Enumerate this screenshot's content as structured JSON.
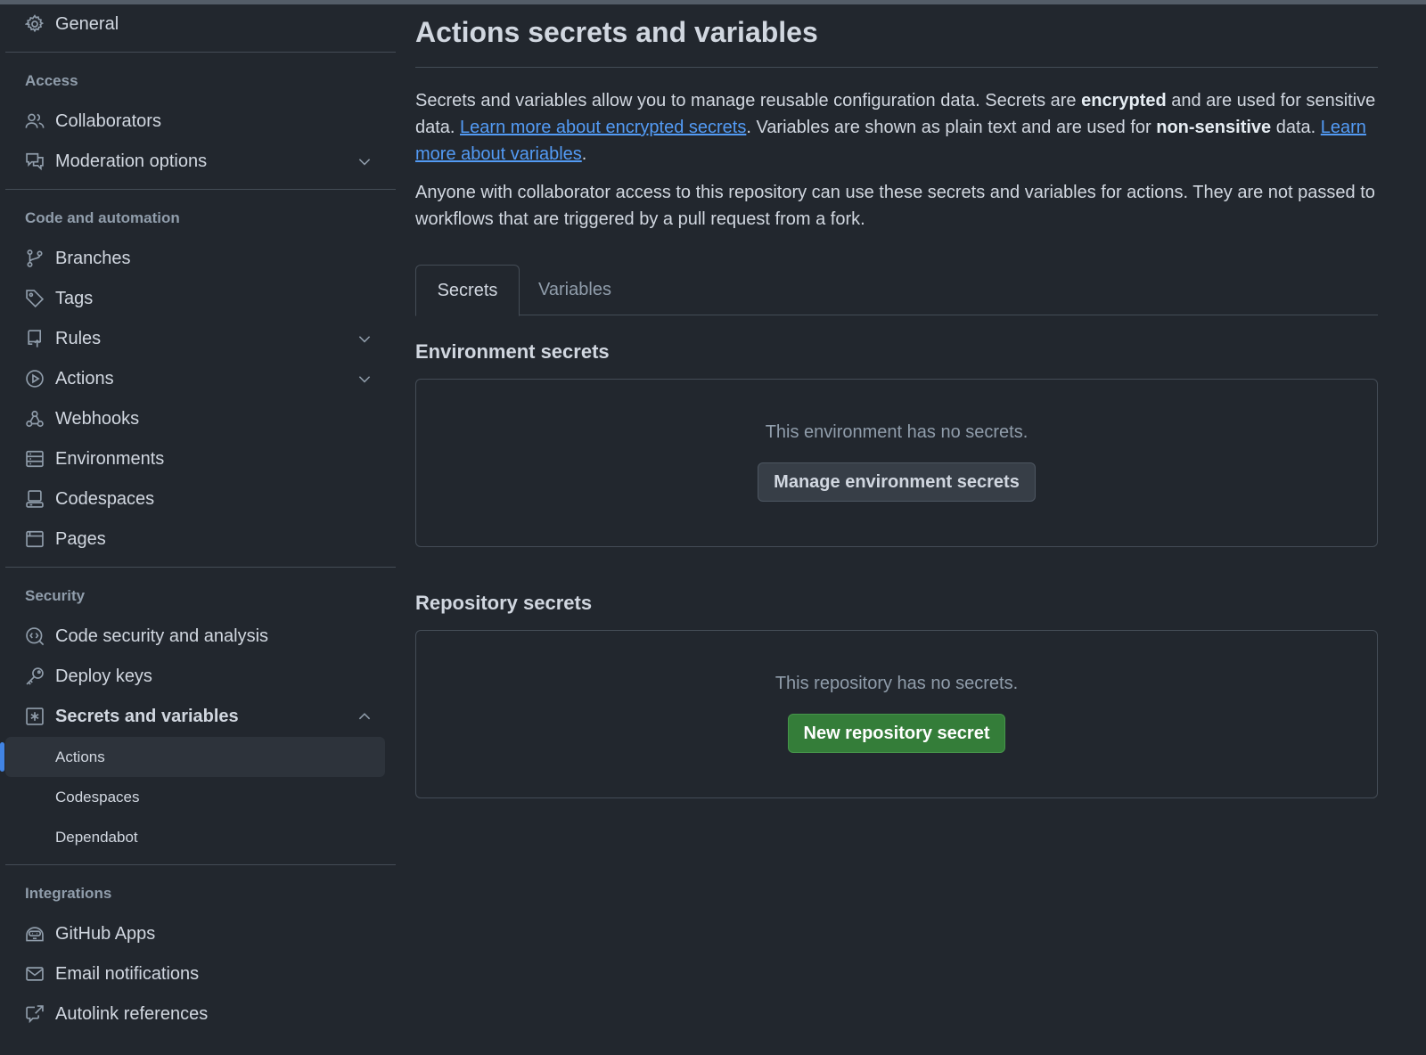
{
  "sidebar": {
    "top_item": {
      "label": "General",
      "icon": "gear-icon"
    },
    "sections": [
      {
        "heading": "Access",
        "items": [
          {
            "label": "Collaborators",
            "icon": "people-icon"
          },
          {
            "label": "Moderation options",
            "icon": "comment-discussion-icon",
            "expandable": true
          }
        ]
      },
      {
        "heading": "Code and automation",
        "items": [
          {
            "label": "Branches",
            "icon": "git-branch-icon"
          },
          {
            "label": "Tags",
            "icon": "tag-icon"
          },
          {
            "label": "Rules",
            "icon": "repo-push-icon",
            "expandable": true
          },
          {
            "label": "Actions",
            "icon": "play-icon",
            "expandable": true
          },
          {
            "label": "Webhooks",
            "icon": "webhook-icon"
          },
          {
            "label": "Environments",
            "icon": "server-icon"
          },
          {
            "label": "Codespaces",
            "icon": "codespaces-icon"
          },
          {
            "label": "Pages",
            "icon": "browser-icon"
          }
        ]
      },
      {
        "heading": "Security",
        "items": [
          {
            "label": "Code security and analysis",
            "icon": "codescan-icon"
          },
          {
            "label": "Deploy keys",
            "icon": "key-icon"
          },
          {
            "label": "Secrets and variables",
            "icon": "key-asterisk-icon",
            "expanded": true,
            "subitems": [
              "Actions",
              "Codespaces",
              "Dependabot"
            ],
            "selected_subitem": "Actions"
          }
        ]
      },
      {
        "heading": "Integrations",
        "items": [
          {
            "label": "GitHub Apps",
            "icon": "hubot-icon"
          },
          {
            "label": "Email notifications",
            "icon": "mail-icon"
          },
          {
            "label": "Autolink references",
            "icon": "cross-reference-icon"
          }
        ]
      }
    ]
  },
  "main": {
    "title": "Actions secrets and variables",
    "intro": {
      "t1": "Secrets and variables allow you to manage reusable configuration data. Secrets are ",
      "b1": "encrypted",
      "t2": " and are used for sensitive data. ",
      "link1": "Learn more about encrypted secrets",
      "t3": ". Variables are shown as plain text and are used for ",
      "b2": "non-sensitive",
      "t4": " data. ",
      "link2": "Learn more about variables",
      "t5": "."
    },
    "notice": "Anyone with collaborator access to this repository can use these secrets and variables for actions. They are not passed to workflows that are triggered by a pull request from a fork.",
    "tabs": [
      {
        "label": "Secrets",
        "active": true
      },
      {
        "label": "Variables",
        "active": false
      }
    ],
    "environment": {
      "title": "Environment secrets",
      "empty_text": "This environment has no secrets.",
      "button": "Manage environment secrets"
    },
    "repository": {
      "title": "Repository secrets",
      "empty_text": "This repository has no secrets.",
      "button": "New repository secret"
    }
  },
  "colors": {
    "background": "#22272e",
    "link": "#539bf5",
    "primary_button": "#347d39",
    "selected_bar": "#4184e4"
  }
}
